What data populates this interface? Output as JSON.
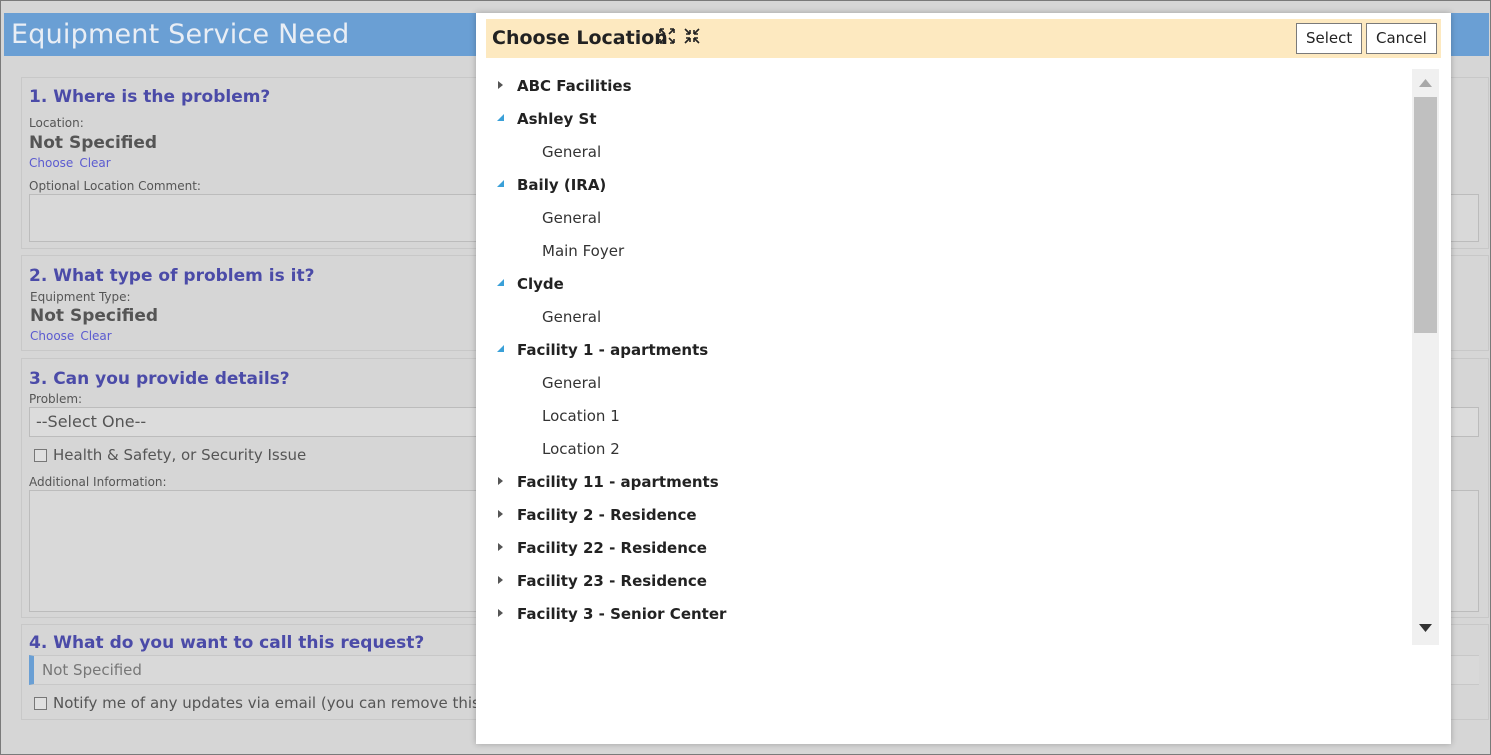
{
  "form": {
    "title": "Equipment Service Need",
    "section1": {
      "title": "1. Where is the problem?",
      "location_label": "Location:",
      "location_value": "Not Specified",
      "choose": "Choose",
      "clear": "Clear",
      "comment_label": "Optional Location Comment:"
    },
    "section2": {
      "title": "2. What type of problem is it?",
      "equipment_label": "Equipment Type:",
      "equipment_value": "Not Specified",
      "choose": "Choose",
      "clear": "Clear"
    },
    "section3": {
      "title": "3. Can you provide details?",
      "problem_label": "Problem:",
      "problem_value": "--Select One--",
      "health_checkbox": "Health & Safety, or Security Issue",
      "additional_label": "Additional Information:"
    },
    "section4": {
      "title": "4. What do you want to call this request?",
      "name_value": "Not Specified",
      "notify_checkbox": "Notify me of any updates via email (you can remove this lat"
    }
  },
  "modal": {
    "title": "Choose Location",
    "select_label": "Select",
    "cancel_label": "Cancel",
    "tree": [
      {
        "label": "ABC Facilities",
        "level": 0,
        "expanded": false
      },
      {
        "label": "Ashley St",
        "level": 0,
        "expanded": true
      },
      {
        "label": "General",
        "level": 1
      },
      {
        "label": "Baily (IRA)",
        "level": 0,
        "expanded": true
      },
      {
        "label": "General",
        "level": 1
      },
      {
        "label": "Main Foyer",
        "level": 1
      },
      {
        "label": "Clyde",
        "level": 0,
        "expanded": true
      },
      {
        "label": "General",
        "level": 1
      },
      {
        "label": "Facility 1 - apartments",
        "level": 0,
        "expanded": true
      },
      {
        "label": "General",
        "level": 1
      },
      {
        "label": "Location 1",
        "level": 1
      },
      {
        "label": "Location 2",
        "level": 1
      },
      {
        "label": "Facility 11 - apartments",
        "level": 0,
        "expanded": false
      },
      {
        "label": "Facility 2 - Residence",
        "level": 0,
        "expanded": false
      },
      {
        "label": "Facility 22 - Residence",
        "level": 0,
        "expanded": false
      },
      {
        "label": "Facility 23 - Residence",
        "level": 0,
        "expanded": false
      },
      {
        "label": "Facility 3 - Senior Center",
        "level": 0,
        "expanded": false
      }
    ]
  },
  "colors": {
    "header_blue": "#6a9fd4",
    "section_title": "#4b4ba8",
    "link": "#5b5bd0",
    "modal_header": "#fde9c0",
    "tree_expanded_caret": "#3aa0d8"
  },
  "icons": {
    "expand_all": "expand-all-icon",
    "collapse_all": "collapse-all-icon"
  }
}
